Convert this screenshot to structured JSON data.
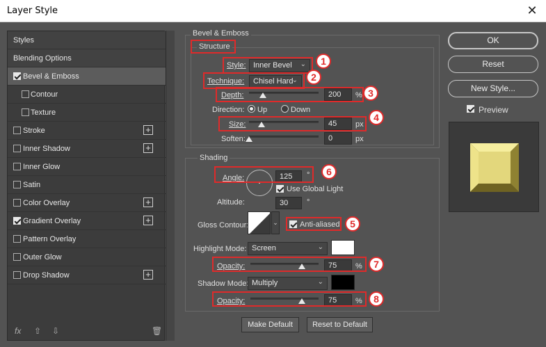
{
  "window": {
    "title": "Layer Style",
    "close_glyph": "✕"
  },
  "styles_list": {
    "items": [
      {
        "label": "Styles",
        "type": "header"
      },
      {
        "label": "Blending Options",
        "type": "header"
      },
      {
        "label": "Bevel & Emboss",
        "checked": true,
        "selected": true
      },
      {
        "label": "Contour",
        "checked": false,
        "sub": true
      },
      {
        "label": "Texture",
        "checked": false,
        "sub": true
      },
      {
        "label": "Stroke",
        "checked": false,
        "plus": true
      },
      {
        "label": "Inner Shadow",
        "checked": false,
        "plus": true
      },
      {
        "label": "Inner Glow",
        "checked": false
      },
      {
        "label": "Satin",
        "checked": false
      },
      {
        "label": "Color Overlay",
        "checked": false,
        "plus": true
      },
      {
        "label": "Gradient Overlay",
        "checked": true,
        "plus": true
      },
      {
        "label": "Pattern Overlay",
        "checked": false
      },
      {
        "label": "Outer Glow",
        "checked": false
      },
      {
        "label": "Drop Shadow",
        "checked": false,
        "plus": true
      }
    ],
    "bottom": {
      "fx": "fx",
      "up": "⇧",
      "down": "⇩",
      "trash": "🗑"
    }
  },
  "bevel": {
    "group_title": "Bevel & Emboss",
    "structure_title": "Structure",
    "style_label": "Style:",
    "style_value": "Inner Bevel",
    "technique_label": "Technique:",
    "technique_value": "Chisel Hard",
    "depth_label": "Depth:",
    "depth_value": "200",
    "depth_unit": "%",
    "depth_level": 0.2,
    "direction_label": "Direction:",
    "direction_up": "Up",
    "direction_down": "Down",
    "size_label": "Size:",
    "size_value": "45",
    "size_unit": "px",
    "size_level": 0.18,
    "soften_label": "Soften:",
    "soften_value": "0",
    "soften_unit": "px",
    "soften_level": 0.0
  },
  "shading": {
    "title": "Shading",
    "angle_label": "Angle:",
    "angle_value": "125",
    "angle_unit": "°",
    "use_global_light": "Use Global Light",
    "altitude_label": "Altitude:",
    "altitude_value": "30",
    "altitude_unit": "°",
    "gloss_contour_label": "Gloss Contour:",
    "anti_aliased": "Anti-aliased",
    "highlight_mode_label": "Highlight Mode:",
    "highlight_mode_value": "Screen",
    "highlight_color": "#ffffff",
    "highlight_opacity_label": "Opacity:",
    "highlight_opacity_value": "75",
    "highlight_opacity_unit": "%",
    "highlight_opacity_level": 0.75,
    "shadow_mode_label": "Shadow Mode:",
    "shadow_mode_value": "Multiply",
    "shadow_color": "#000000",
    "shadow_opacity_label": "Opacity:",
    "shadow_opacity_value": "75",
    "shadow_opacity_unit": "%",
    "shadow_opacity_level": 0.75
  },
  "buttons": {
    "make_default": "Make Default",
    "reset_to_default": "Reset to Default",
    "ok": "OK",
    "reset": "Reset",
    "new_style": "New Style...",
    "preview": "Preview"
  },
  "annotations": [
    "1",
    "2",
    "3",
    "4",
    "5",
    "6",
    "7",
    "8"
  ],
  "colors": {
    "accent_red": "#e02a2a",
    "panel_bg": "#535353",
    "preview_face": "#e3d77c"
  }
}
